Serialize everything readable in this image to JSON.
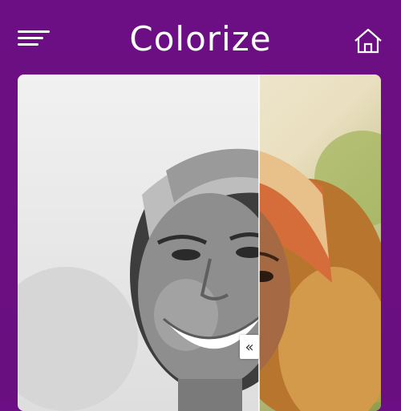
{
  "app": {
    "title": "Colorize"
  },
  "icons": {
    "menu": "hamburger-menu-icon",
    "home": "home-icon",
    "handle": "double-chevron-left-icon"
  },
  "compare": {
    "handle_glyph": "«",
    "split_fraction": 0.66
  },
  "colors": {
    "header_bg": "#6d0f84",
    "text": "#ffffff"
  }
}
